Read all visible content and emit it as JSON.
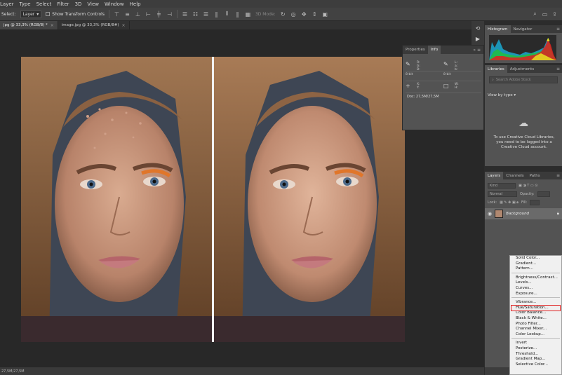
{
  "menubar": {
    "items": [
      "Layer",
      "Type",
      "Select",
      "Filter",
      "3D",
      "View",
      "Window",
      "Help"
    ]
  },
  "options": {
    "select_label": "Select:",
    "select_value": "Layer",
    "transform_label": "Show Transform Controls",
    "mode_3d": "3D Mode:"
  },
  "tabs": [
    {
      "label": "jpg @ 33,3% (RGB/8) *",
      "close": "×"
    },
    {
      "label": "image.jpg @ 33,3% (RGB/8#)",
      "close": "×"
    }
  ],
  "status": {
    "text": "27,5M/27,5M"
  },
  "info": {
    "tabs": [
      "Properties",
      "Info"
    ],
    "active_tab": "Info",
    "rows": [
      [
        {
          "glyph": "✎",
          "channels": "R:\nG:\nB:"
        },
        {
          "glyph": "✎",
          "channels": "L:\na:\nb:"
        }
      ],
      [
        {
          "glyph": "",
          "channels": "8-bit"
        },
        {
          "glyph": "",
          "channels": "8-bit"
        }
      ],
      [
        {
          "glyph": "+",
          "channels": "X:\nY:"
        },
        {
          "glyph": "□",
          "channels": "W:\nH:"
        }
      ]
    ],
    "doc": "Doc: 27,5M/27,5M"
  },
  "histogram": {
    "tabs": [
      "Histogram",
      "Navigator"
    ],
    "active_tab": "Histogram"
  },
  "libraries": {
    "tabs": [
      "Libraries",
      "Adjustments"
    ],
    "active_tab": "Libraries",
    "search_placeholder": "Search Adobe Stock",
    "view_by": "View by type",
    "message": "To use Creative Cloud Libraries, you need to be logged into a Creative Cloud account."
  },
  "layers": {
    "tabs": [
      "Layers",
      "Channels",
      "Paths"
    ],
    "active_tab": "Layers",
    "kind": "Kind",
    "blend": "Normal",
    "opacity_label": "Opacity:",
    "lock_label": "Lock:",
    "fill_label": "Fill:",
    "layer_name": "Background"
  },
  "adjustment_menu": {
    "groups": [
      [
        "Solid Color...",
        "Gradient...",
        "Pattern..."
      ],
      [
        "Brightness/Contrast...",
        "Levels...",
        "Curves...",
        "Exposure..."
      ],
      [
        "Vibrance...",
        "Hue/Saturation...",
        "Color Balance...",
        "Black & White...",
        "Photo Filter...",
        "Channel Mixer...",
        "Color Lookup..."
      ],
      [
        "Invert",
        "Posterize...",
        "Threshold...",
        "Gradient Map...",
        "Selective Color..."
      ]
    ],
    "highlighted": "Hue/Saturation..."
  },
  "colors": {
    "menu_bg": "#f0f0f0",
    "highlight_border": "#e02020",
    "panel_bg": "#535353",
    "app_bg": "#282828"
  }
}
